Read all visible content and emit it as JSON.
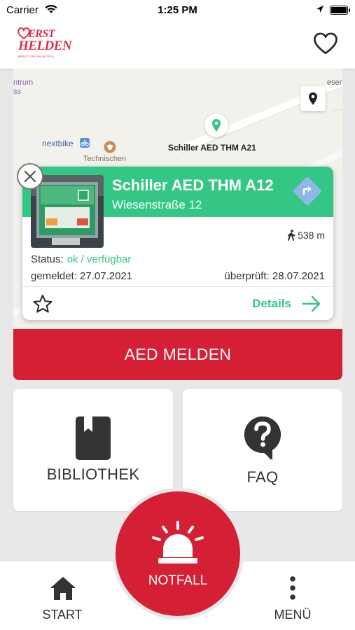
{
  "status_bar": {
    "carrier": "Carrier",
    "time": "1:25 PM"
  },
  "header": {
    "logo_text_top": "ERST",
    "logo_text_main": "HELDEN",
    "logo_tagline": "BEREIT FÜR DEN NOTFALL"
  },
  "map": {
    "labels": {
      "zentrum": "ntrum",
      "zentrum_2": "ss",
      "nextbike": "nextbike",
      "technischen": "Technischen",
      "marker_name": "Schiller AED THM A21",
      "street_fragment": "esen"
    }
  },
  "aed_card": {
    "title": "Schiller AED THM A12",
    "address": "Wiesenstraße 12",
    "distance": "538 m",
    "status_label": "Status:",
    "status_value": "ok / verfügbar",
    "reported": "gemeldet: 27.07.2021",
    "checked": "überprüft: 28.07.2021",
    "details_label": "Details"
  },
  "report_button": "AED MELDEN",
  "tiles": {
    "library": "BIBLIOTHEK",
    "faq": "FAQ"
  },
  "tabbar": {
    "start": "START",
    "emergency": "NOTFALL",
    "menu": "MENÜ"
  },
  "colors": {
    "brand_red": "#d41f35",
    "accent_green": "#34c684",
    "nav_blue": "#8fb8e8"
  },
  "icons": {
    "favorite": "heart-outline-icon",
    "map_location": "map-pin-icon",
    "close": "close-icon",
    "directions": "directions-icon",
    "walking": "walking-icon",
    "star": "star-outline-icon",
    "arrow": "arrow-right-icon",
    "library": "book-icon",
    "faq": "question-bubble-icon",
    "home": "home-icon",
    "alarm": "siren-icon",
    "menu": "more-vertical-icon"
  }
}
